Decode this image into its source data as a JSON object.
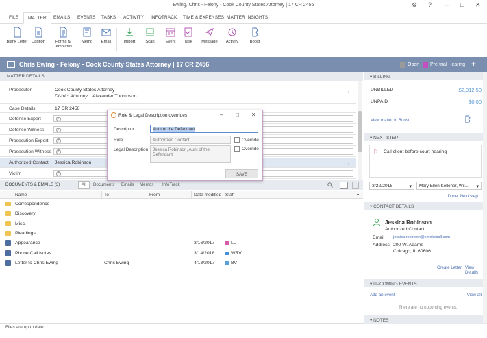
{
  "window": {
    "title": "Ewing, Chris - Felony - Cook County States Attorney | 17 CR 2456",
    "controls": {
      "settings": "⚙",
      "help": "?",
      "minimize": "–",
      "maximize": "□",
      "close": "✕"
    }
  },
  "menu": {
    "tabs": [
      "FILE",
      "MATTER",
      "EMAILS",
      "EVENTS",
      "TASKS",
      "ACTIVITY",
      "INFOTRACK",
      "TIME & EXPENSES",
      "MATTER INSIGHTS"
    ],
    "active": "MATTER"
  },
  "ribbon": {
    "buttons": [
      {
        "label": "Blank Letter",
        "icon": "blank-letter-icon"
      },
      {
        "label": "Caption",
        "icon": "caption-icon"
      },
      {
        "label": "Forms & Templates",
        "icon": "forms-icon"
      },
      {
        "label": "Memo",
        "icon": "memo-icon"
      },
      {
        "label": "Email",
        "icon": "email-icon"
      },
      {
        "label": "Import",
        "icon": "import-icon"
      },
      {
        "label": "Scan",
        "icon": "scan-icon"
      },
      {
        "label": "Event",
        "icon": "event-icon"
      },
      {
        "label": "Task",
        "icon": "task-icon"
      },
      {
        "label": "Message",
        "icon": "message-icon"
      },
      {
        "label": "Activity",
        "icon": "activity-icon"
      },
      {
        "label": "Boost",
        "icon": "boost-icon"
      }
    ]
  },
  "header": {
    "title": "Chris Ewing - Felony - Cook County States Attorney | 17 CR 2456",
    "legend": [
      {
        "label": "Open",
        "color": "#9a9a9a"
      },
      {
        "label": "Pre-trial Hearing",
        "color": "#c54fc0"
      }
    ],
    "add": "+"
  },
  "matter_details": {
    "heading": "MATTER DETAILS",
    "prosecutor": {
      "label": "Prosecutor",
      "line1": "Cook County States Attorney",
      "line2_role": "District Attorney",
      "line2_name": "Alexander Thompson"
    },
    "case_details": {
      "label": "Case Details",
      "value": "17 CR 2456"
    },
    "empty_fields": [
      "Defense Expert",
      "Defense Witness",
      "Prosecution Expert",
      "Prosecution Witness"
    ],
    "authorized_contact": {
      "label": "Authorized Contact",
      "value": "Jessica Robinson"
    },
    "victim": {
      "label": "Victim"
    }
  },
  "documents": {
    "heading": "DOCUMENTS & EMAILS (3)",
    "tabs": [
      "All",
      "Documents",
      "Emails",
      "Memos",
      "InfoTrack"
    ],
    "columns": [
      "Name",
      "To",
      "From",
      "Date modified",
      "Staff"
    ],
    "rows": [
      {
        "kind": "folder",
        "name": "Correspondence",
        "to": "",
        "from": "",
        "date": "",
        "staff": "",
        "staff_color": ""
      },
      {
        "kind": "folder",
        "name": "Discovery",
        "to": "",
        "from": "",
        "date": "",
        "staff": "",
        "staff_color": ""
      },
      {
        "kind": "folder",
        "name": "Misc.",
        "to": "",
        "from": "",
        "date": "",
        "staff": "",
        "staff_color": ""
      },
      {
        "kind": "folder",
        "name": "Pleadings",
        "to": "",
        "from": "",
        "date": "",
        "staff": "",
        "staff_color": ""
      },
      {
        "kind": "doc",
        "name": "Appearance",
        "to": "",
        "from": "",
        "date": "3/16/2017",
        "staff": "LL",
        "staff_color": "#d85aa8"
      },
      {
        "kind": "doc",
        "name": "Phone Call Notes",
        "to": "",
        "from": "",
        "date": "3/14/2018",
        "staff": "WRV",
        "staff_color": "#4a90d9"
      },
      {
        "kind": "doc",
        "name": "Letter to Chris Ewing",
        "to": "Chris Ewing",
        "from": "",
        "date": "4/13/2017",
        "staff": "BV",
        "staff_color": "#5aa0d8"
      }
    ]
  },
  "status": {
    "text": "Files are up to date"
  },
  "billing": {
    "heading": "BILLING",
    "unbilled_label": "UNBILLED",
    "unbilled_value": "$2,012.50",
    "unpaid_label": "UNPAID",
    "unpaid_value": "$0.00",
    "link": "View matter in Boost"
  },
  "next_step": {
    "heading": "NEXT STEP",
    "text": "Call client before court hearing",
    "date": "3/22/2018",
    "assignee": "Mary Ellen Kelleher, Wil...",
    "done_link": "Done. Next step..."
  },
  "contact_details": {
    "heading": "CONTACT DETAILS",
    "name": "Jessica Robinson",
    "role": "Authorized Contact",
    "email_label": "Email",
    "email": "jessica.robinson@smokeball.com",
    "address_label": "Address",
    "address1": "200 W. Adams",
    "address2": "Chicago, IL 60606",
    "create_letter": "Create Letter",
    "view_details": "View Details"
  },
  "upcoming_events": {
    "heading": "UPCOMING EVENTS",
    "add": "Add an event",
    "view_all": "View all",
    "empty": "There are no upcoming events."
  },
  "notes": {
    "heading": "NOTES"
  },
  "dialog": {
    "title": "Role & Legal Description overrides",
    "descriptor_label": "Descriptor",
    "descriptor_value": "Aunt of the Defendant",
    "role_label": "Role",
    "role_value": "Authorized Contact",
    "legal_label": "Legal Description",
    "legal_value": "Jessica Robinson, Aunt of the Defendant",
    "override1": "Override",
    "override2": "Override",
    "save": "SAVE"
  },
  "colors": {
    "accent": "#7a8fb0",
    "link": "#4a6fb0",
    "billing": "#5b9bd5",
    "dialog_border": "#c9a2c9"
  }
}
